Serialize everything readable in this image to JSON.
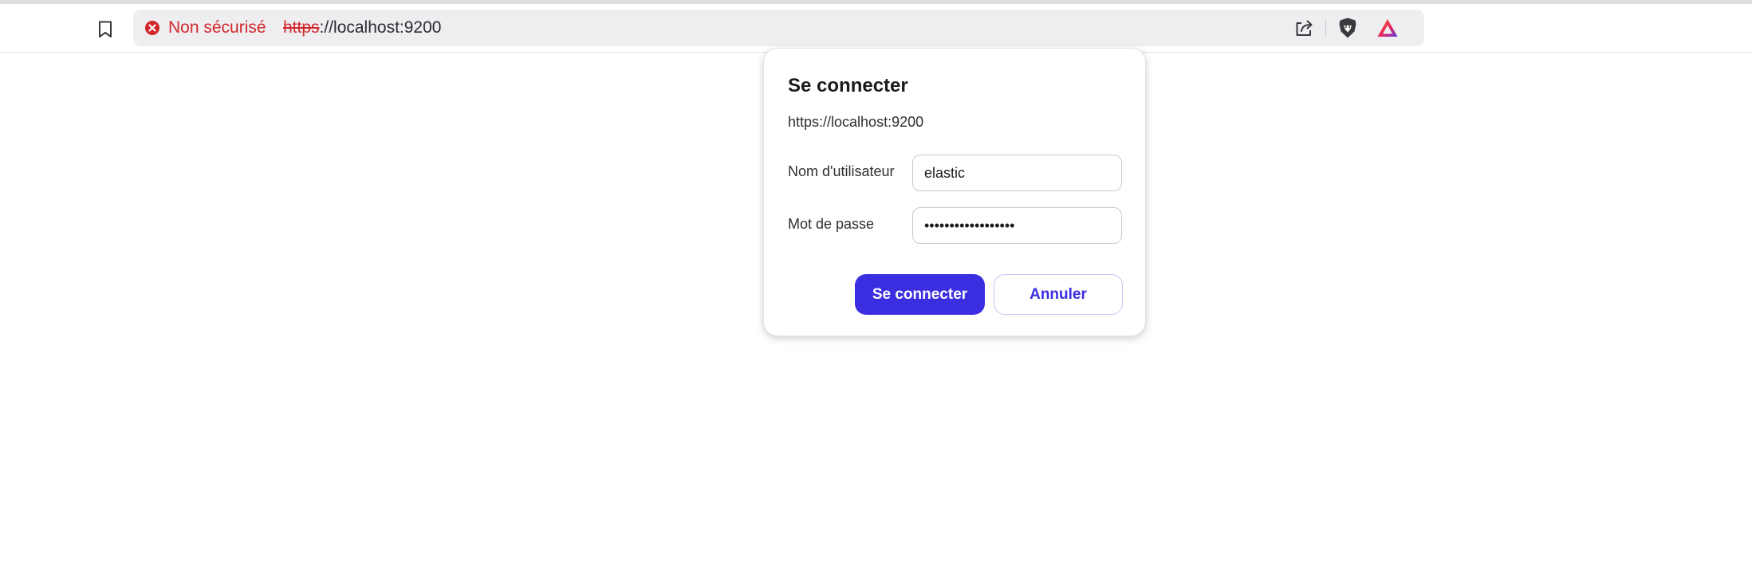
{
  "browser": {
    "security_label": "Non sécurisé",
    "url_scheme": "https",
    "url_rest": "://localhost:9200",
    "icons": {
      "bookmark": "bookmark-icon",
      "security_warning": "security-warning-icon",
      "share": "share-icon",
      "shields": "brave-shields-icon",
      "rewards": "brave-rewards-icon"
    },
    "colors": {
      "insecure": "#d1282c",
      "omnibox_bg": "#eeeef1"
    }
  },
  "dialog": {
    "title": "Se connecter",
    "origin": "https://localhost:9200",
    "username_label": "Nom d'utilisateur",
    "username_value": "elastic",
    "password_label": "Mot de passe",
    "password_value": "••••••••••••••••••",
    "login_button": "Se connecter",
    "cancel_button": "Annuler",
    "colors": {
      "accent": "#3b2ee0"
    }
  }
}
